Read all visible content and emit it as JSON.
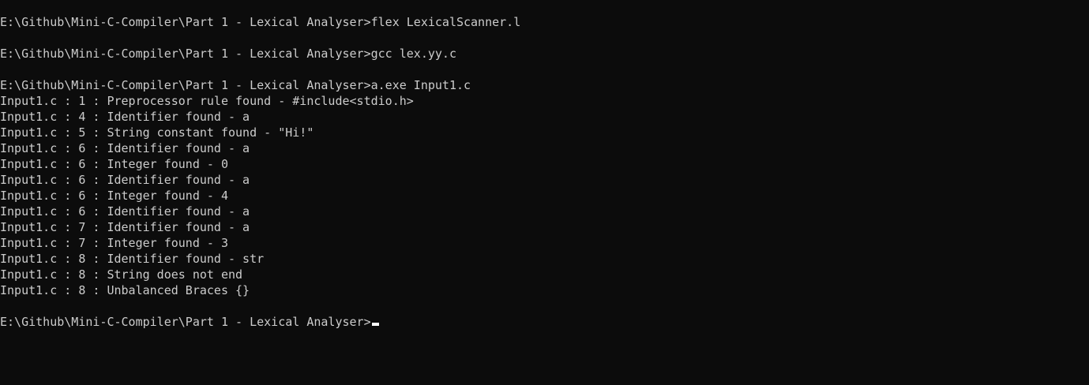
{
  "terminal": {
    "colors": {
      "background": "#0c0c0c",
      "text": "#cccccc",
      "cursor": "#ffffff"
    },
    "lines": [
      "E:\\Github\\Mini-C-Compiler\\Part 1 - Lexical Analyser>flex LexicalScanner.l",
      "",
      "E:\\Github\\Mini-C-Compiler\\Part 1 - Lexical Analyser>gcc lex.yy.c",
      "",
      "E:\\Github\\Mini-C-Compiler\\Part 1 - Lexical Analyser>a.exe Input1.c",
      "Input1.c : 1 : Preprocessor rule found - #include<stdio.h>",
      "Input1.c : 4 : Identifier found - a",
      "Input1.c : 5 : String constant found - \"Hi!\"",
      "Input1.c : 6 : Identifier found - a",
      "Input1.c : 6 : Integer found - 0",
      "Input1.c : 6 : Identifier found - a",
      "Input1.c : 6 : Integer found - 4",
      "Input1.c : 6 : Identifier found - a",
      "Input1.c : 7 : Identifier found - a",
      "Input1.c : 7 : Integer found - 3",
      "Input1.c : 8 : Identifier found - str",
      "Input1.c : 8 : String does not end",
      "Input1.c : 8 : Unbalanced Braces {}",
      ""
    ],
    "prompt": "E:\\Github\\Mini-C-Compiler\\Part 1 - Lexical Analyser>"
  }
}
